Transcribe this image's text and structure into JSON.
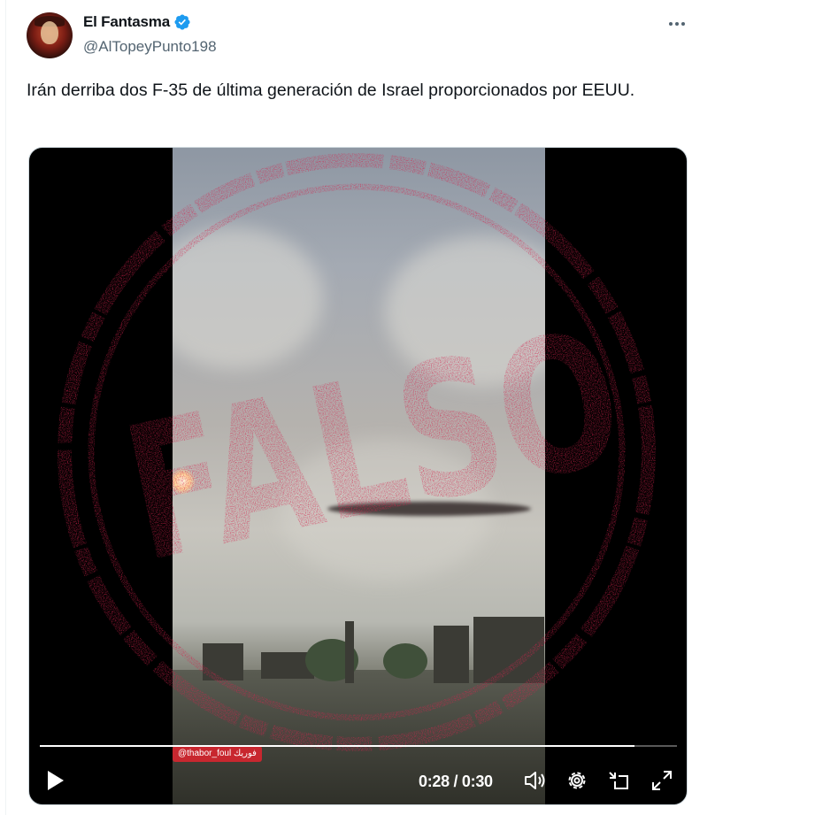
{
  "tweet": {
    "display_name": "El Fantasma",
    "handle": "@AlTopeyPunto198",
    "text": "Irán derriba dos F-35 de última generación de Israel proporcionados por EEUU.",
    "verified_icon": "verified-badge-icon",
    "more_icon": "more-options-icon"
  },
  "media": {
    "stamp_text": "FALSO",
    "video_watermark": "@thabor_foul فوريك",
    "player": {
      "current_time": "0:28",
      "duration": "0:30",
      "time_display": "0:28 / 0:30",
      "progress": 0.933,
      "icons": [
        "play-icon",
        "volume-icon",
        "settings-icon",
        "exit-fullscreen-icon",
        "fullscreen-icon"
      ]
    }
  },
  "colors": {
    "verified": "#1d9bf0",
    "stamp": "#d5234d",
    "secondary_text": "#536471"
  }
}
